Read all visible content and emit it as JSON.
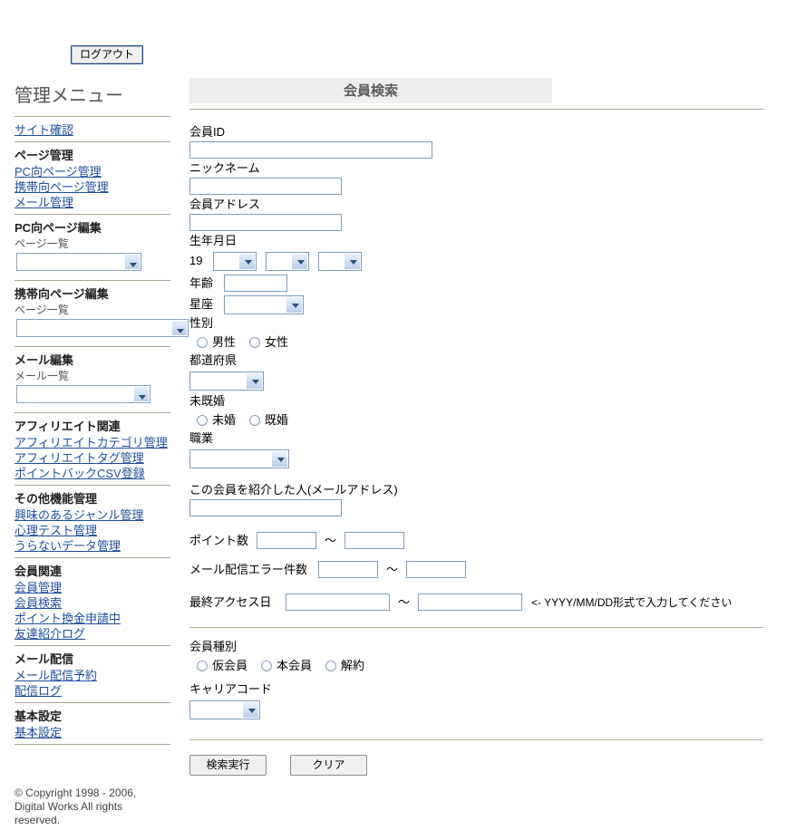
{
  "sidebar": {
    "logout_label": "ログアウト",
    "title": "管理メニュー",
    "site_check": "サイト確認",
    "sections": [
      {
        "heading": "ページ管理",
        "links": [
          "PC向ページ管理",
          "携帯向ページ管理",
          "メール管理"
        ]
      },
      {
        "heading": "PC向ページ編集",
        "sub_label": "ページ一覧",
        "select_value": ""
      },
      {
        "heading": "携帯向ページ編集",
        "sub_label": "ページ一覧",
        "select_value": ""
      },
      {
        "heading": "メール編集",
        "sub_label": "メール一覧",
        "select_value": ""
      },
      {
        "heading": "アフィリエイト関連",
        "links": [
          "アフィリエイトカテゴリ管理",
          "アフィリエイトタグ管理",
          "ポイントバックCSV登録"
        ]
      },
      {
        "heading": "その他機能管理",
        "links": [
          "興味のあるジャンル管理",
          "心理テスト管理",
          "うらないデータ管理"
        ]
      },
      {
        "heading": "会員関連",
        "links": [
          "会員管理",
          "会員検索",
          "ポイント換金申請中",
          "友達紹介ログ"
        ]
      },
      {
        "heading": "メール配信",
        "links": [
          "メール配信予約",
          "配信ログ"
        ]
      },
      {
        "heading": "基本設定",
        "links": [
          "基本設定"
        ]
      }
    ],
    "copyright": "© Copyright 1998 - 2006, Digital Works All rights reserved."
  },
  "main": {
    "page_title": "会員検索",
    "fields": {
      "member_id_label": "会員ID",
      "member_id_value": "",
      "nickname_label": "ニックネーム",
      "nickname_value": "",
      "address_label": "会員アドレス",
      "address_value": "",
      "birthday_label": "生年月日",
      "birthday_century": "19",
      "birthday_year_value": "",
      "birthday_month_value": "",
      "birthday_day_value": "",
      "age_label": "年齢",
      "age_value": "",
      "zodiac_label": "星座",
      "zodiac_value": "",
      "gender_label": "性別",
      "gender_male": "男性",
      "gender_female": "女性",
      "prefecture_label": "都道府県",
      "prefecture_value": "",
      "marital_label": "未既婚",
      "marital_single": "未婚",
      "marital_married": "既婚",
      "occupation_label": "職業",
      "occupation_value": "",
      "referrer_label": "この会員を紹介した人(メールアドレス)",
      "referrer_value": "",
      "points_label": "ポイント数",
      "points_from": "",
      "points_to": "",
      "mail_error_label": "メール配信エラー件数",
      "mail_error_from": "",
      "mail_error_to": "",
      "last_access_label": "最終アクセス日",
      "last_access_from": "",
      "last_access_to": "",
      "last_access_hint": "<- YYYY/MM/DD形式で入力してください",
      "member_type_label": "会員種別",
      "member_type_temp": "仮会員",
      "member_type_full": "本会員",
      "member_type_cancel": "解約",
      "carrier_label": "キャリアコード",
      "carrier_value": "",
      "range_separator": "〜"
    },
    "buttons": {
      "search": "検索実行",
      "clear": "クリア"
    }
  }
}
